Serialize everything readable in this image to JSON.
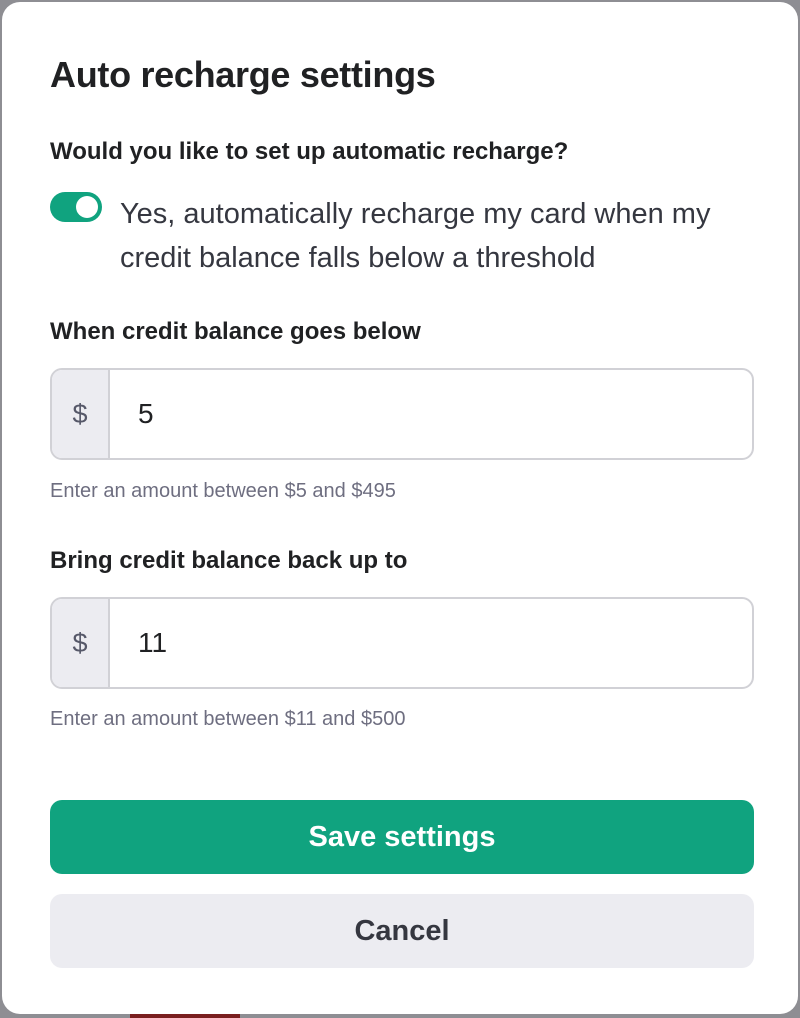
{
  "dialog": {
    "title": "Auto recharge settings",
    "question": "Would you like to set up automatic recharge?",
    "toggle": {
      "enabled": true,
      "label": "Yes, automatically recharge my card when my credit balance falls below a threshold"
    },
    "threshold": {
      "label": "When credit balance goes below",
      "prefix": "$",
      "value": "5",
      "helper": "Enter an amount between $5 and $495"
    },
    "target": {
      "label": "Bring credit balance back up to",
      "prefix": "$",
      "value": "11",
      "helper": "Enter an amount between $11 and $500"
    },
    "buttons": {
      "save": "Save settings",
      "cancel": "Cancel"
    }
  },
  "colors": {
    "accent": "#10a37f",
    "secondary_button": "#ececf1",
    "border": "#d1d1d6",
    "helper_text": "#6e6e80"
  }
}
